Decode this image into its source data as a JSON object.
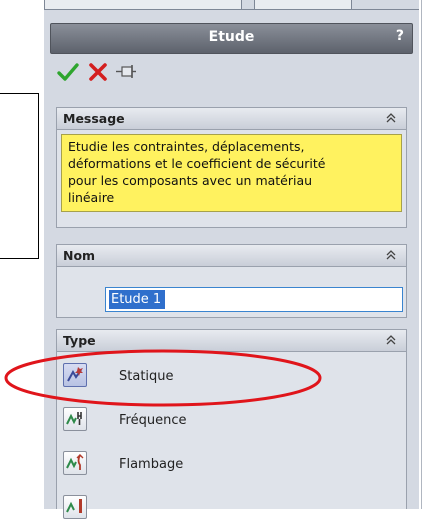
{
  "title_bar": {
    "title": "Etude",
    "help": "?"
  },
  "toolbar": {
    "ok_icon": "check-icon",
    "cancel_icon": "close-icon",
    "pin_icon": "pushpin-icon"
  },
  "groups": {
    "message": {
      "title": "Message",
      "lines": [
        "Etudie les contraintes, déplacements,",
        "déformations et le coefficient de sécurité",
        "pour les composants avec un matériau",
        "linéaire"
      ]
    },
    "name": {
      "title": "Nom",
      "value": "Etude 1"
    },
    "type": {
      "title": "Type",
      "items": [
        {
          "label": "Statique",
          "icon": "static-study-icon",
          "selected": true
        },
        {
          "label": "Fréquence",
          "icon": "frequency-study-icon",
          "selected": false
        },
        {
          "label": "Flambage",
          "icon": "buckling-study-icon",
          "selected": false
        }
      ]
    }
  },
  "colors": {
    "title_bar": "#6f747e",
    "panel_bg": "#d4d9e2",
    "message_bg": "#fff25f",
    "selection": "#2f6fcc",
    "annotation": "#e0151b",
    "ok": "#2ea52e",
    "cancel": "#d41f1f"
  }
}
